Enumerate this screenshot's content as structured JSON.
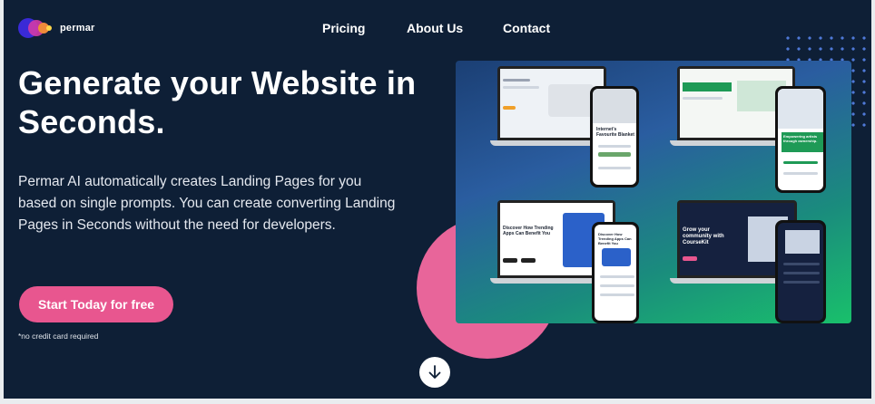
{
  "brand": {
    "name": "permar"
  },
  "nav": {
    "items": [
      "Pricing",
      "About Us",
      "Contact"
    ]
  },
  "hero": {
    "title": "Generate your Website in Seconds.",
    "description": "Permar AI automatically creates Landing Pages for you based on single prompts. You can create converting Landing Pages in Seconds without the need for developers.",
    "cta_label": "Start Today for free",
    "note": "*no credit card required"
  },
  "showcase": {
    "mock1_headline": "Internet's Favourite Blanket",
    "mock2_headline": "Empowering artists through ownership.",
    "mock3_headline": "Discover How Trending Apps Can Benefit You",
    "mock4_headline": "Grow your community with CourseKit"
  },
  "icons": {
    "scroll": "arrow-down-icon"
  },
  "colors": {
    "background": "#0e1f36",
    "accent": "#e8568f",
    "pink_circle": "#e8659a"
  }
}
